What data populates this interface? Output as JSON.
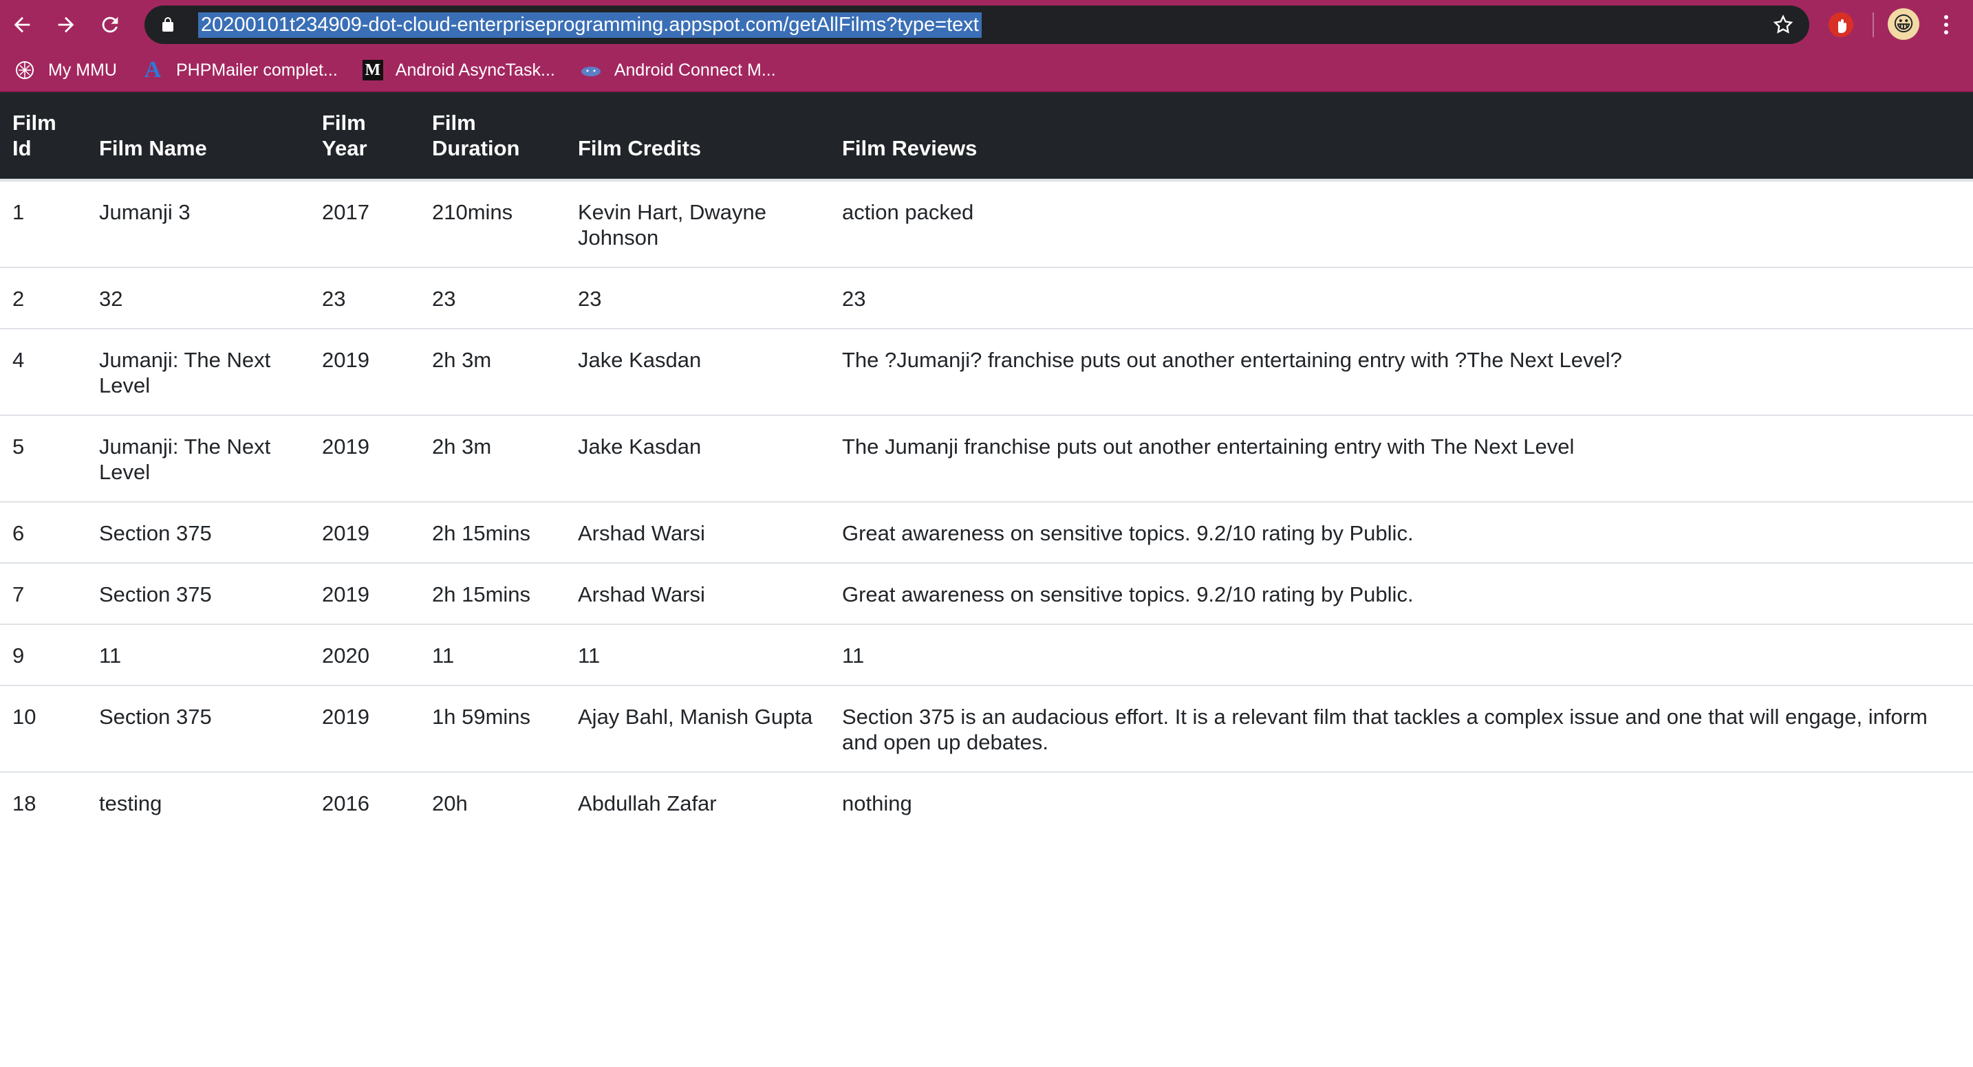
{
  "browser": {
    "url": "20200101t234909-dot-cloud-enterpriseprogramming.appspot.com/getAllFilms?type=text",
    "bookmarks": [
      {
        "label": "My MMU",
        "icon": "mmu-icon"
      },
      {
        "label": "PHPMailer complet...",
        "icon": "a-letter-icon"
      },
      {
        "label": "Android AsyncTask...",
        "icon": "medium-m-icon"
      },
      {
        "label": "Android Connect M...",
        "icon": "android-icon"
      }
    ]
  },
  "table": {
    "headers": {
      "id": [
        "Film",
        "Id"
      ],
      "name": "Film Name",
      "year": [
        "Film",
        "Year"
      ],
      "duration": [
        "Film",
        "Duration"
      ],
      "credits": "Film Credits",
      "reviews": "Film Reviews"
    },
    "rows": [
      {
        "id": "1",
        "name": "Jumanji 3",
        "year": "2017",
        "duration": "210mins",
        "credits": "Kevin Hart, Dwayne Johnson",
        "reviews": "action packed"
      },
      {
        "id": "2",
        "name": "32",
        "year": "23",
        "duration": "23",
        "credits": "23",
        "reviews": "23"
      },
      {
        "id": "4",
        "name": "Jumanji: The Next Level",
        "year": "2019",
        "duration": "2h 3m",
        "credits": "Jake Kasdan",
        "reviews": "The ?Jumanji? franchise puts out another entertaining entry with ?The Next Level?"
      },
      {
        "id": "5",
        "name": "Jumanji: The Next Level",
        "year": "2019",
        "duration": "2h 3m",
        "credits": "Jake Kasdan",
        "reviews": "The Jumanji franchise puts out another entertaining entry with The Next Level"
      },
      {
        "id": "6",
        "name": "Section 375",
        "year": "2019",
        "duration": "2h 15mins",
        "credits": "Arshad Warsi",
        "reviews": "Great awareness on sensitive topics. 9.2/10 rating by Public."
      },
      {
        "id": "7",
        "name": "Section 375",
        "year": "2019",
        "duration": "2h 15mins",
        "credits": "Arshad Warsi",
        "reviews": "Great awareness on sensitive topics. 9.2/10 rating by Public."
      },
      {
        "id": "9",
        "name": "11",
        "year": "2020",
        "duration": "11",
        "credits": "11",
        "reviews": "11"
      },
      {
        "id": "10",
        "name": "Section 375",
        "year": "2019",
        "duration": "1h 59mins",
        "credits": "Ajay Bahl, Manish Gupta",
        "reviews": "Section 375 is an audacious effort. It is a relevant film that tackles a complex issue and one that will engage, inform and open up debates."
      },
      {
        "id": "18",
        "name": "testing",
        "year": "2016",
        "duration": "20h",
        "credits": "Abdullah Zafar",
        "reviews": "nothing"
      }
    ]
  },
  "colors": {
    "chrome": "#a3275f",
    "omnibox": "#202124",
    "table_header": "#212529",
    "row_border": "#dee2e6"
  }
}
